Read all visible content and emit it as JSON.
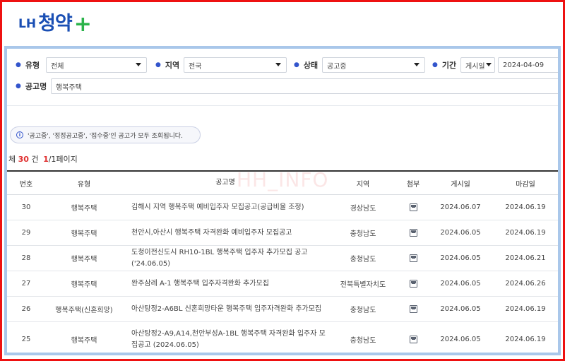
{
  "logo": {
    "lh": "LH",
    "brand": "청약",
    "plus": "+"
  },
  "filters": {
    "type": {
      "label": "유형",
      "value": "전체"
    },
    "region": {
      "label": "지역",
      "value": "전국"
    },
    "status": {
      "label": "상태",
      "value": "공고중"
    },
    "period": {
      "label": "기간",
      "basis": "게시일",
      "date": "2024-04-09"
    },
    "title": {
      "label": "공고명",
      "value": "행복주택"
    }
  },
  "notice": {
    "icon": "info-icon",
    "text": "'공고중', '정정공고중', '접수중'인 공고가 모두 조회됩니다."
  },
  "summary": {
    "prefix": "체",
    "total": "30",
    "unit": "건",
    "page_current": "1",
    "page_rest": "/1페이지"
  },
  "watermark": "HH_INFO",
  "table": {
    "headers": {
      "no": "번호",
      "type": "유형",
      "title": "공고명",
      "region": "지역",
      "attach": "첨부",
      "posted": "게시일",
      "due": "마감일"
    },
    "rows": [
      {
        "no": "30",
        "type": "행복주택",
        "title": "김해시 지역 행복주택 예비입주자 모집공고(공급비율 조정)",
        "region": "경상남도",
        "attach": "file-icon",
        "posted": "2024.06.07",
        "due": "2024.06.19"
      },
      {
        "no": "29",
        "type": "행복주택",
        "title": "천안시,아산시 행복주택 자격완화 예비입주자 모집공고",
        "region": "충청남도",
        "attach": "file-icon",
        "posted": "2024.06.05",
        "due": "2024.06.19"
      },
      {
        "no": "28",
        "type": "행복주택",
        "title": "도청이전신도시 RH10-1BL 행복주택 입주자 추가모집 공고('24.06.05)",
        "region": "충청남도",
        "attach": "file-icon",
        "posted": "2024.06.05",
        "due": "2024.06.21"
      },
      {
        "no": "27",
        "type": "행복주택",
        "title": "완주삼례 A-1 행복주택 입주자격완화 추가모집",
        "region": "전북특별자치도",
        "attach": "file-icon",
        "posted": "2024.06.05",
        "due": "2024.06.26"
      },
      {
        "no": "26",
        "type": "행복주택(신혼희망)",
        "title": "아산탕정2-A6BL 신혼희망타운 행복주택 입주자격완화 추가모집",
        "region": "충청남도",
        "attach": "file-icon",
        "posted": "2024.06.05",
        "due": "2024.06.19"
      },
      {
        "no": "25",
        "type": "행복주택",
        "title": "아산탕정2-A9,A14,천안부성A-1BL 행복주택 자격완화 입주자 모집공고 (2024.06.05)",
        "region": "충청남도",
        "attach": "file-icon",
        "posted": "2024.06.05",
        "due": "2024.06.19"
      }
    ]
  }
}
